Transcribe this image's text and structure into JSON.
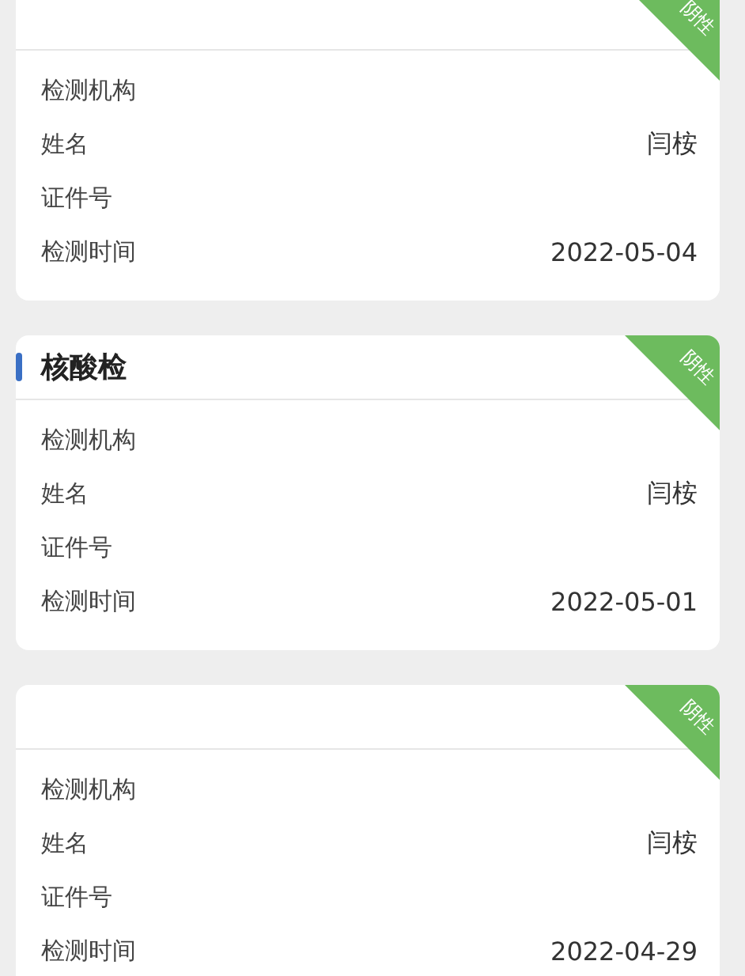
{
  "cards": [
    {
      "badge": "阴性",
      "rows": [
        {
          "label": "检测机构"
        },
        {
          "label": "姓名",
          "value": "闫桉"
        },
        {
          "label": "证件号"
        },
        {
          "label": "检测时间",
          "value": "2022-05-04"
        }
      ]
    },
    {
      "title": "核酸检",
      "badge": "阴性",
      "rows": [
        {
          "label": "检测机构"
        },
        {
          "label": "姓名",
          "value": "闫桉"
        },
        {
          "label": "证件号"
        },
        {
          "label": "检测时间",
          "value": "2022-05-01"
        }
      ]
    },
    {
      "badge": "阴性",
      "rows": [
        {
          "label": "检测机构"
        },
        {
          "label": "姓名",
          "value": "闫桉"
        },
        {
          "label": "证件号"
        },
        {
          "label": "检测时间",
          "value": "2022-04-29"
        }
      ]
    }
  ]
}
